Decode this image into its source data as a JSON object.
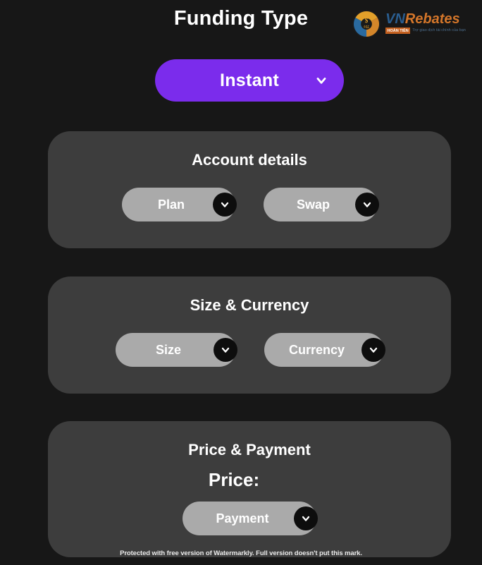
{
  "header": {
    "title": "Funding Type",
    "logo": {
      "name_prefix": "VN",
      "name_suffix": "Rebates",
      "badge": "HOÀN TIỀN",
      "tagline": "Trợ giao dịch tài chính của bạn"
    }
  },
  "funding_type": {
    "selected": "Instant",
    "chevron_icon": "chevron-down-icon",
    "accent_color": "#7b2cec"
  },
  "cards": [
    {
      "id": "account",
      "title": "Account details",
      "controls": [
        {
          "label": "Plan",
          "chevron_icon": "chevron-down-icon"
        },
        {
          "label": "Swap",
          "chevron_icon": "chevron-down-icon"
        }
      ]
    },
    {
      "id": "size",
      "title": "Size & Currency",
      "controls": [
        {
          "label": "Size",
          "chevron_icon": "chevron-down-icon"
        },
        {
          "label": "Currency",
          "chevron_icon": "chevron-down-icon"
        }
      ]
    },
    {
      "id": "price",
      "title": "Price & Payment",
      "price_label": "Price:",
      "controls": [
        {
          "label": "Payment",
          "chevron_icon": "chevron-down-icon"
        }
      ]
    }
  ],
  "watermark": {
    "text": "Protected with free version of Watermarkly. Full version doesn't put this mark."
  },
  "colors": {
    "background": "#171717",
    "card": "#3d3d3d",
    "pill": "#aaaaaa",
    "knob": "#0d0d0d",
    "accent": "#7b2cec",
    "text": "#ffffff"
  }
}
